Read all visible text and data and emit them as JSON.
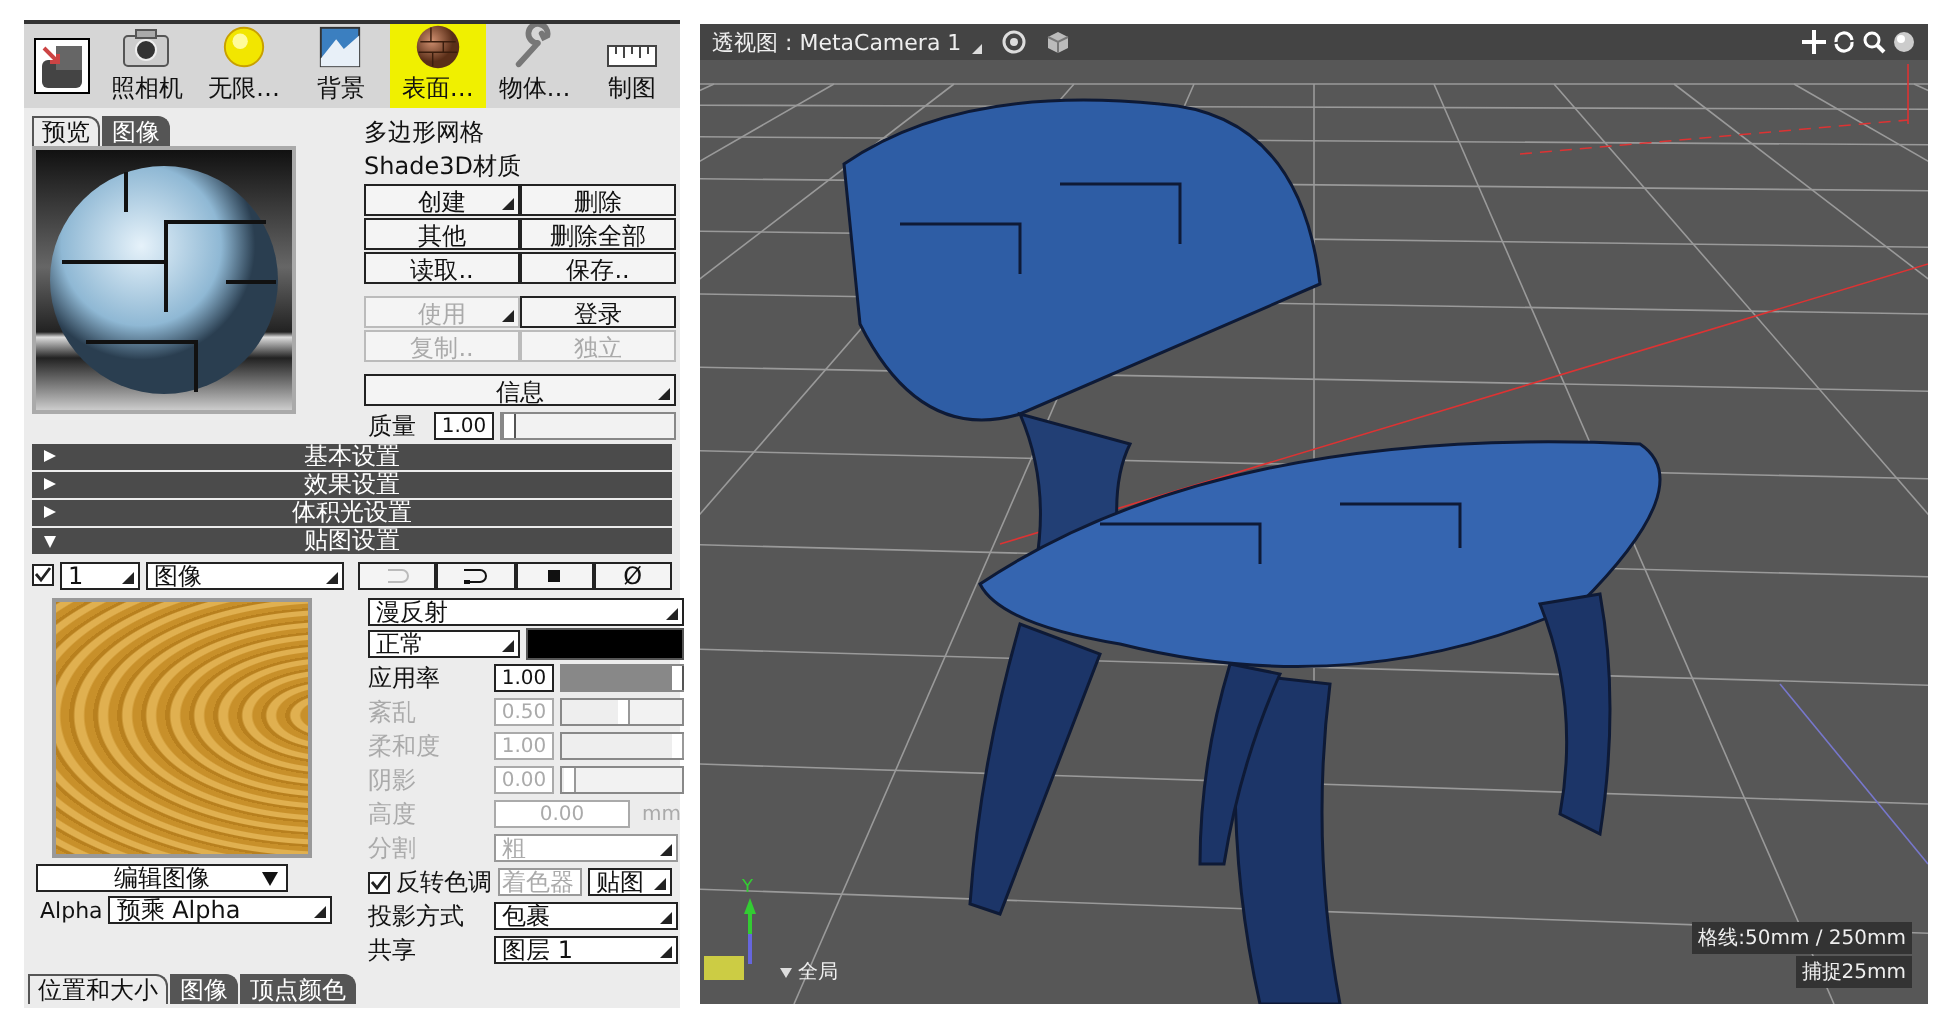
{
  "toolbar": [
    {
      "kind": "selector",
      "selected": false
    },
    {
      "kind": "camera",
      "label": "照相机",
      "selected": false
    },
    {
      "kind": "sun",
      "label": "无限…",
      "selected": false
    },
    {
      "kind": "landscape",
      "label": "背景",
      "selected": false
    },
    {
      "kind": "sphere",
      "label": "表面…",
      "selected": true
    },
    {
      "kind": "wrench",
      "label": "物体…",
      "selected": false
    },
    {
      "kind": "ruler",
      "label": "制图",
      "selected": false
    }
  ],
  "preview_tabs": [
    {
      "label": "预览",
      "selected": true
    },
    {
      "label": "图像",
      "selected": false
    }
  ],
  "material": {
    "name": "多边形网格",
    "type": "Shade3D材质"
  },
  "button_rows": [
    [
      {
        "label": "创建",
        "dropdown": true,
        "disabled": false
      },
      {
        "label": "删除",
        "dropdown": false,
        "disabled": false
      }
    ],
    [
      {
        "label": "其他",
        "dropdown": false,
        "disabled": false
      },
      {
        "label": "删除全部",
        "dropdown": false,
        "disabled": false
      }
    ],
    [
      {
        "label": "读取..",
        "dropdown": false,
        "disabled": false
      },
      {
        "label": "保存..",
        "dropdown": false,
        "disabled": false
      }
    ],
    [
      {
        "label": "使用",
        "dropdown": true,
        "disabled": true
      },
      {
        "label": "登录",
        "dropdown": false,
        "disabled": false
      }
    ],
    [
      {
        "label": "复制..",
        "dropdown": false,
        "disabled": true
      },
      {
        "label": "独立",
        "dropdown": false,
        "disabled": true
      }
    ]
  ],
  "info_button": "信息",
  "quality": {
    "label": "质量",
    "value": "1.00",
    "level": 0.0
  },
  "sections": [
    {
      "label": "基本设置",
      "expanded": false
    },
    {
      "label": "效果设置",
      "expanded": false
    },
    {
      "label": "体积光设置",
      "expanded": false
    },
    {
      "label": "贴图设置",
      "expanded": true
    }
  ],
  "mapping": {
    "enabled": true,
    "layer": "1",
    "type": "图像",
    "actions": [
      {
        "kind": "rotate-left",
        "disabled": true
      },
      {
        "kind": "rotate-right",
        "disabled": false
      },
      {
        "kind": "square",
        "disabled": false
      },
      {
        "kind": "text",
        "label": "Ø",
        "disabled": false
      }
    ],
    "edit_image": "编辑图像",
    "alpha_label": "Alpha",
    "alpha_value": "预乘 Alpha",
    "channel": "漫反射",
    "blend": "正常",
    "params": [
      {
        "label": "应用率",
        "value": "1.00",
        "level": 1.0,
        "disabled": false
      },
      {
        "label": "紊乱",
        "value": "0.50",
        "level": 0.5,
        "disabled": true
      },
      {
        "label": "柔和度",
        "value": "1.00",
        "level": 1.0,
        "disabled": true
      },
      {
        "label": "阴影",
        "value": "0.00",
        "level": 0.0,
        "disabled": true
      }
    ],
    "height": {
      "label": "高度",
      "value": "0.00",
      "unit": "mm",
      "disabled": true
    },
    "division": {
      "label": "分割",
      "value": "粗",
      "disabled": true
    },
    "invert": {
      "label": "反转色调",
      "checked": true
    },
    "shader_button": {
      "label": "着色器",
      "disabled": true
    },
    "map_button": "贴图",
    "projection": {
      "label": "投影方式",
      "value": "包裹"
    },
    "share": {
      "label": "共享",
      "value": "图层 1"
    }
  },
  "bottom_tabs": [
    {
      "label": "位置和大小",
      "selected": true
    },
    {
      "label": "图像",
      "selected": false
    },
    {
      "label": "顶点颜色",
      "selected": false
    }
  ],
  "viewport": {
    "title": "透视图 : MetaCamera 1",
    "axis_label": "Y",
    "scope": "全局",
    "grid": "格线:50mm / 250mm",
    "snap": "捕捉25mm"
  }
}
